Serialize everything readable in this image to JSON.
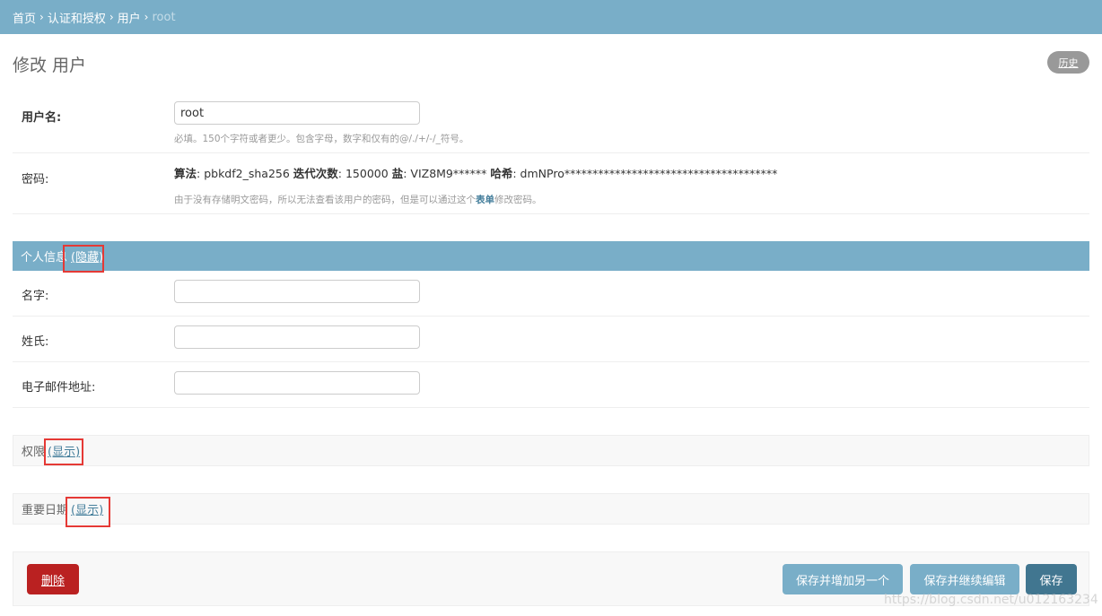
{
  "breadcrumbs": {
    "home": "首页",
    "app": "认证和授权",
    "model": "用户",
    "current": "root",
    "separator": "›"
  },
  "page_title": "修改 用户",
  "history_button": "历史",
  "username": {
    "label": "用户名:",
    "value": "root",
    "help": "必填。150个字符或者更少。包含字母，数字和仅有的@/./+/-/_符号。"
  },
  "password": {
    "label": "密码:",
    "algorithm_label": "算法",
    "algorithm_value": ": pbkdf2_sha256 ",
    "iterations_label": "迭代次数",
    "iterations_value": ": 150000 ",
    "salt_label": "盐",
    "salt_value": ": VIZ8M9****** ",
    "hash_label": "哈希",
    "hash_value": ": dmNPro**************************************",
    "help_before": "由于没有存储明文密码，所以无法查看该用户的密码，但是可以通过这个",
    "help_link": "表单",
    "help_after": "修改密码。"
  },
  "personal_info": {
    "title": "个人信息",
    "toggle": "(隐藏)",
    "first_name_label": "名字:",
    "last_name_label": "姓氏:",
    "email_label": "电子邮件地址:",
    "first_name_value": "",
    "last_name_value": "",
    "email_value": ""
  },
  "permissions": {
    "title": "权限",
    "toggle": "(显示)"
  },
  "important_dates": {
    "title": "重要日期",
    "toggle": "(显示)"
  },
  "actions": {
    "delete": "删除",
    "save_add_another": "保存并增加另一个",
    "save_continue": "保存并继续编辑",
    "save": "保存"
  },
  "watermark": "https://blog.csdn.net/u012163234",
  "colors": {
    "header_blue": "#79aec8",
    "dark_blue": "#417690",
    "delete_red": "#ba2121",
    "highlight_red": "#e53935"
  }
}
